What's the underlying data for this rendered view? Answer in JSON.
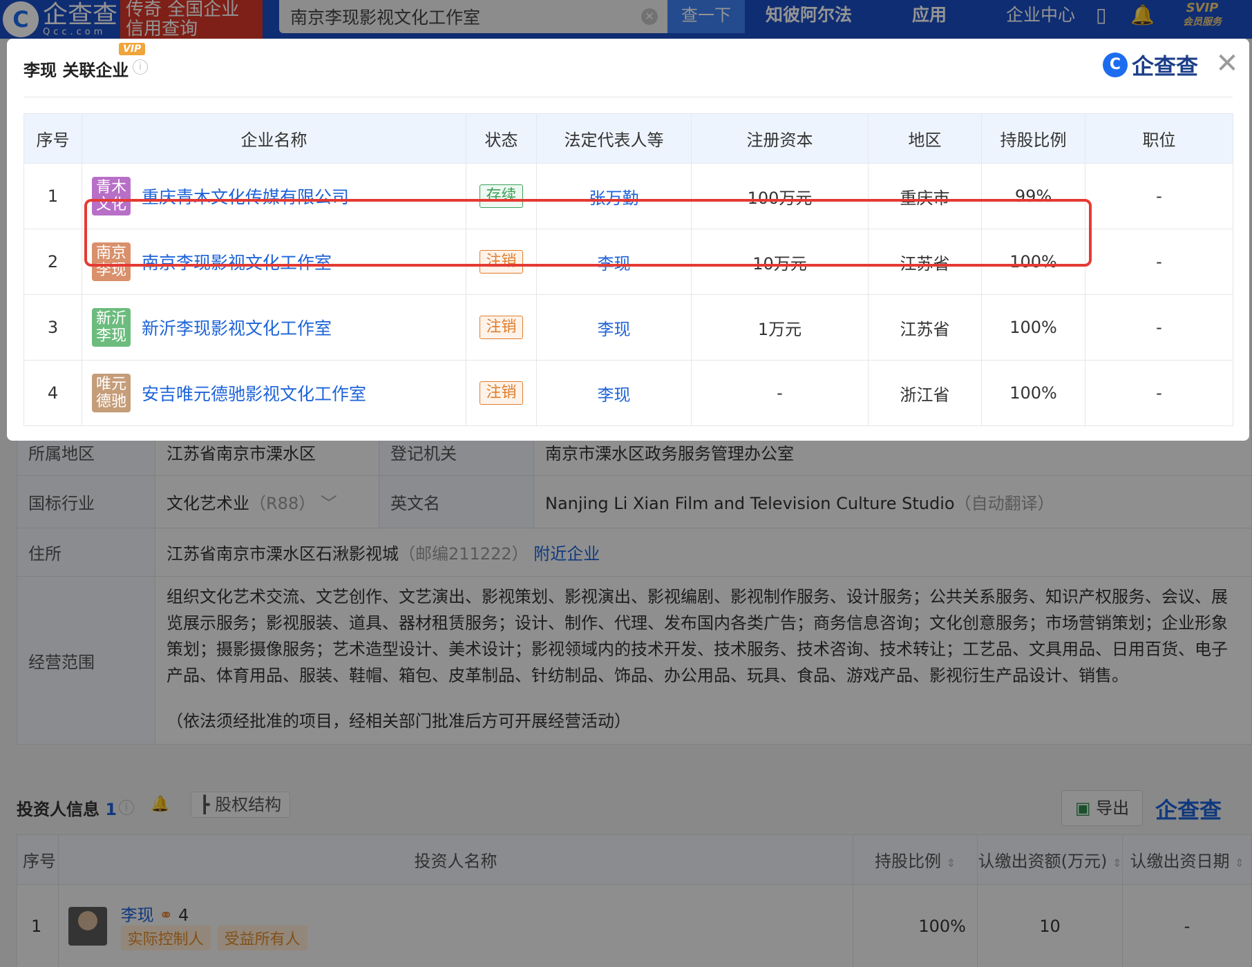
{
  "topbar": {
    "logo_zh": "企查查",
    "logo_en": "Qcc.com",
    "logo_glyph": "C",
    "slogan": "传奇 全国企业信用查询",
    "search_value": "南京李现影视文化工作室",
    "search_button": "查一下",
    "ai_label": "知彼阿尔法",
    "app_label": "应用",
    "center_label": "企业中心",
    "svip": "SVIP",
    "svip_sub": "会员服务"
  },
  "page": {
    "info_rows": [
      {
        "label": "所属地区",
        "value": "江苏省南京市溧水区",
        "label2": "登记机关",
        "value2": "南京市溧水区政务服务管理办公室"
      },
      {
        "label": "国标行业",
        "value": "文化艺术业",
        "value_muted": "（R88）",
        "label2": "英文名",
        "value2": "Nanjing Li Xian Film and Television Culture Studio",
        "value2_muted": "（自动翻译）"
      },
      {
        "label": "住所",
        "value": "江苏省南京市溧水区石湫影视城",
        "value_muted": "（邮编211222）",
        "link": "附近企业"
      },
      {
        "label": "经营范围",
        "value": "组织文化艺术交流、文艺创作、文艺演出、影视策划、影视演出、影视编剧、影视制作服务、设计服务；公共关系服务、知识产权服务、会议、展览展示服务；影视服装、道具、器材租赁服务；设计、制作、代理、发布国内各类广告；商务信息咨询；文化创意服务；市场营销策划；企业形象策划；摄影摄像服务；艺术造型设计、美术设计；影视领域内的技术开发、技术服务、技术咨询、技术转让；工艺品、文具用品、日用百货、电子产品、体育用品、服装、鞋帽、箱包、皮革制品、针纺制品、饰品、办公用品、玩具、食品、游戏产品、影视衍生产品设计、销售。",
        "note": "（依法须经批准的项目，经相关部门批准后方可开展经营活动）"
      }
    ],
    "investors": {
      "title": "投资人信息",
      "count": "1",
      "structure_button": "股权结构",
      "export_button": "导出",
      "logo": "企查查",
      "columns": [
        "序号",
        "投资人名称",
        "持股比例",
        "认缴出资额(万元)",
        "认缴出资日期"
      ],
      "rows": [
        {
          "index": "1",
          "name": "李现",
          "relation_count": "4",
          "tags": [
            "实际控制人",
            "受益所有人"
          ],
          "share": "100%",
          "amount": "10",
          "date": "-"
        }
      ]
    }
  },
  "modal": {
    "title": "李现 关联企业",
    "vip": "VIP",
    "brand": "企查查",
    "brand_glyph": "C",
    "columns": [
      "序号",
      "企业名称",
      "状态",
      "法定代表人等",
      "注册资本",
      "地区",
      "持股比例",
      "职位"
    ],
    "rows": [
      {
        "index": "1",
        "logo_text": "青木文化",
        "logo_color": "#b86fc7",
        "name": "重庆青木文化传媒有限公司",
        "status": "存续",
        "status_type": "ok",
        "legal": "张万勤",
        "capital": "100万元",
        "region": "重庆市",
        "share": "99%",
        "position": "-"
      },
      {
        "index": "2",
        "logo_text": "南京李现",
        "logo_color": "#d9906b",
        "name": "南京李现影视文化工作室",
        "status": "注销",
        "status_type": "off",
        "legal": "李现",
        "capital": "10万元",
        "region": "江苏省",
        "share": "100%",
        "position": "-"
      },
      {
        "index": "3",
        "logo_text": "新沂李现",
        "logo_color": "#6cbc7e",
        "name": "新沂李现影视文化工作室",
        "status": "注销",
        "status_type": "off",
        "legal": "李现",
        "capital": "1万元",
        "region": "江苏省",
        "share": "100%",
        "position": "-"
      },
      {
        "index": "4",
        "logo_text": "唯元德驰",
        "logo_color": "#c59d79",
        "name": "安吉唯元德驰影视文化工作室",
        "status": "注销",
        "status_type": "off",
        "legal": "李现",
        "capital": "-",
        "region": "浙江省",
        "share": "100%",
        "position": "-"
      }
    ],
    "highlight_color": "#e43a33"
  }
}
